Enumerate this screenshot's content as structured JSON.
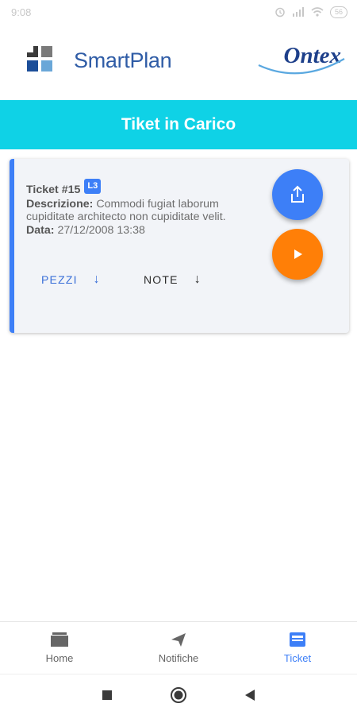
{
  "status": {
    "time": "9:08",
    "battery": "56"
  },
  "brand": {
    "app_name": "SmartPlan",
    "client_name": "Ontex"
  },
  "page": {
    "title": "Tiket in Carico"
  },
  "ticket": {
    "title": "Ticket #15",
    "level": "L3",
    "description_label": "Descrizione:",
    "description": "Commodi fugiat laborum cupiditate architecto non cupiditate velit.",
    "date_label": "Data:",
    "date": "27/12/2008 13:38",
    "pezzi_label": "PEZZI",
    "note_label": "NOTE"
  },
  "nav": {
    "items": [
      {
        "label": "Home",
        "icon": "inbox-icon"
      },
      {
        "label": "Notifiche",
        "icon": "send-icon"
      },
      {
        "label": "Ticket",
        "icon": "ticket-icon"
      }
    ],
    "active": "Ticket"
  },
  "colors": {
    "accent": "#3d7ff7",
    "header": "#0fd2e6",
    "play": "#ff7f07"
  }
}
